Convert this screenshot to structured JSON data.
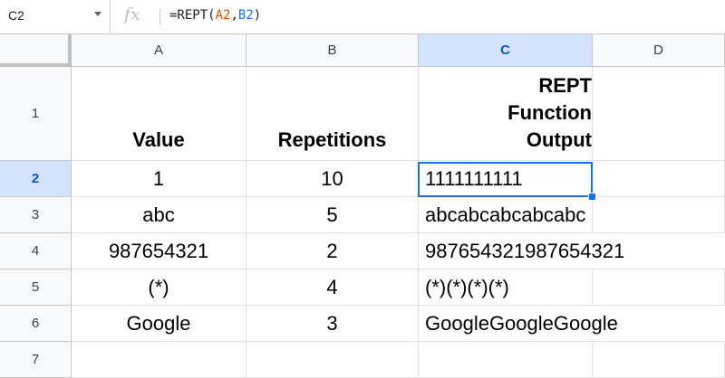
{
  "name_box": {
    "ref": "C2"
  },
  "formula_bar": {
    "fx": "fx",
    "formula_prefix": "=REPT(",
    "formula_arg1": "A2",
    "formula_sep": ",",
    "formula_arg2": "B2",
    "formula_suffix": ")"
  },
  "columns": [
    "A",
    "B",
    "C",
    "D"
  ],
  "rows": [
    "1",
    "2",
    "3",
    "4",
    "5",
    "6",
    "7"
  ],
  "header_row": {
    "a": "Value",
    "b": "Repetitions",
    "c_line1": "REPT",
    "c_line2": "Function",
    "c_line3": "Output"
  },
  "data_rows": [
    {
      "a": "1",
      "b": "10",
      "c": "1111111111"
    },
    {
      "a": "abc",
      "b": "5",
      "c": "abcabcabcabcabc"
    },
    {
      "a": "987654321",
      "b": "2",
      "c": "987654321987654321"
    },
    {
      "a": "(*)",
      "b": "4",
      "c": "(*)(*)(*)(*)"
    },
    {
      "a": "Google",
      "b": "3",
      "c": "GoogleGoogleGoogle"
    }
  ],
  "colors": {
    "selection": "#1a73e8",
    "header_bg": "#f8f9fa",
    "active_header_bg": "#d3e3fd",
    "ref_a2": "#d35400",
    "ref_b2": "#1a73e8"
  }
}
